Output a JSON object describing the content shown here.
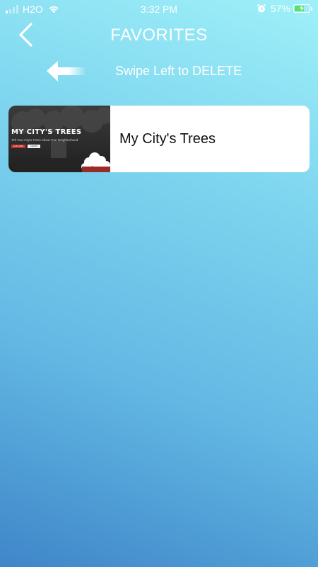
{
  "status_bar": {
    "carrier": "H2O",
    "time": "3:32 PM",
    "battery_percent": "57%",
    "signal_bars_active": 1,
    "signal_bars_total": 4,
    "battery_level": 0.57,
    "charging": true
  },
  "header": {
    "title": "FAVORITES",
    "back_icon": "chevron-left-icon"
  },
  "hint": {
    "text": "Swipe Left to DELETE",
    "icon": "arrow-left-icon"
  },
  "favorites": [
    {
      "label": "My City's Trees",
      "thumbnail": {
        "title": "MY CITY'S TREES",
        "subtitle": "Tell Your City's Trees About Your Neighborhood",
        "primary_button": "EXPLORE",
        "secondary_button": "LEARN"
      }
    }
  ],
  "colors": {
    "bg_top": "#9ff0f8",
    "bg_bottom": "#3f86c9",
    "card": "#ffffff",
    "thumb_accent": "#c0312b"
  }
}
